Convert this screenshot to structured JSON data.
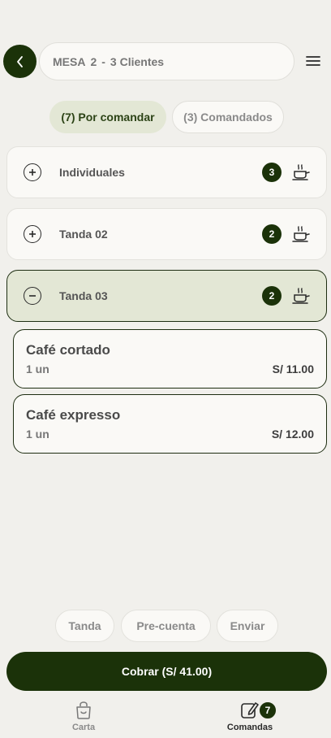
{
  "header": {
    "table_label": "MESA",
    "table_number": "2",
    "separator": "-",
    "clients": "3 Clientes"
  },
  "filter_tabs": [
    {
      "label": "(7) Por comandar",
      "active": true
    },
    {
      "label": "(3) Comandados",
      "active": false
    }
  ],
  "groups": [
    {
      "label": "Individuales",
      "count": "3",
      "expanded": false
    },
    {
      "label": "Tanda 02",
      "count": "2",
      "expanded": false
    },
    {
      "label": "Tanda 03",
      "count": "2",
      "expanded": true
    }
  ],
  "items": [
    {
      "name": "Café cortado",
      "qty": "1 un",
      "price": "S/ 11.00"
    },
    {
      "name": "Café expresso",
      "qty": "1 un",
      "price": "S/ 12.00"
    }
  ],
  "actions": {
    "tanda": "Tanda",
    "pre_cuenta": "Pre-cuenta",
    "enviar": "Enviar",
    "cobrar": "Cobrar (S/ 41.00)"
  },
  "bottom_nav": {
    "carta": "Carta",
    "comandas": "Comandas",
    "comandas_badge": "7"
  },
  "colors": {
    "accent": "#1b3209",
    "active_tint": "#e3e7d5",
    "background": "#f1f0ec"
  }
}
